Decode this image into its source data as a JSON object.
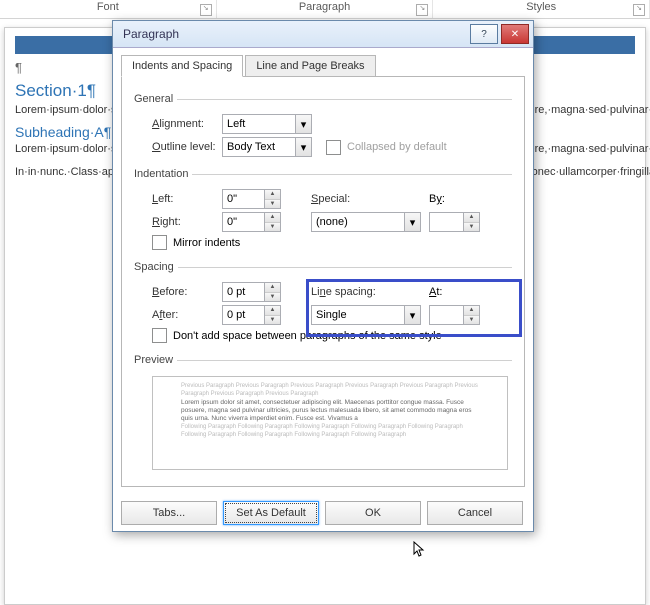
{
  "ribbon": {
    "groups": [
      "Font",
      "Paragraph",
      "Styles"
    ]
  },
  "document": {
    "heading1": "Section·1¶",
    "heading2": "Subheading·A¶",
    "lorem1": "Lorem·ipsum·dolor·sit·amet,·consectetuer·adipiscing·elit.·Maecenas·porttitor·congue·massa.·Fusce·posuere,·magna·sed·pulvinar·ultricies,·purus·lectus·malesuada·libero,·sit·amet·commodo·magna·eros·quis·urna.·Nunc·viverra·imperdiet·enim.·Fusce·est.·Vivamus·a·tellus.·Pellentesque·habitant·morbi·tristique·senectus·et·netus·et·malesuada·fames·ac·turpis·egestas.·Proin·pharetra·nonummy·pede.·Mauris·et·orci.·Aenean·nec·lorem.·In·porttitor.·Donec·laoreet·nonummy·augue.·Suspendisse·dui·purus,·scelerisque·at,·vulputate·vitae,·pretium·mattis,·nunc.·Mauris·eget·neque·at·sem·venenatis·eleifend.·Ut·nonummy.·Fusce·aliquet·pede·non·pede.·Suspendisse·dapibus·lorem·pellentesque·magna.·Integer·nulla.·Donec·blandit·feugiat·ligula.·Donec·hendrerit,·felis·et·imperdiet·euismod,·purus·ipsum·pretium·metus,·in·lacinia·nulla·nisl·eget·sapien.¶",
    "lorem2": "Lorem·ipsum·dolor·sit·amet,·consectetuer·adipiscing·elit.·Maecenas·porttitor·congue·massa.·Fusce·posuere,·magna·sed·pulvinar·ultricies,·purus·lectus·malesuada·libero,·sit·amet·commodo·magna·eros·quis·urna.·Nunc·viverra·imperdiet·enim.·Fusce·est.·Vivamus·a·tellus.·Pellentesque·habitant·morbi·tristique·senectus·et·netus·et·malesuada·fames·ac·turpis·egestas.·Proin·pharetra·nonummy·pede.·Mauris·et·orci.·Aenean·nec·lorem.·In·porttitor.·Donec·laoreet·nonummy·augue.·Suspendisse·dui·purus,·scelerisque·at,·vulputate·vitae,·pretium·mattis,·nunc.·Mauris·eget·neque·at·sem·venenatis·eleifend.·Ut·nonummy.·Fusce·aliquet·pede·non·pede.·Suspendisse·dapibus·lorem·pellentesque·magna.·Integer·nulla.·Donec·blandit·feugiat·ligula.·Donec·hendrerit,·felis·et·imperdiet·euismod,·purus·ipsum·pretium·metus,·in·lacinia·nulla·nisl·eget·sapien.¶",
    "footer_line": "In·in·nunc.·Class·aptent·taciti·sociosqu·ad·litora·torquent·per·conubia·nostra,·per·inceptos·hymenaeos.·Donec·ullamcorper·fringilla·eros.·Fusce·in·sapien·eu·purus·dapibus·commodo.·Cum·sociis·natoque"
  },
  "dialog": {
    "title": "Paragraph",
    "tabs": {
      "active": "Indents and Spacing",
      "inactive": "Line and Page Breaks"
    },
    "general": {
      "legend": "General",
      "alignment_label": "Alignment:",
      "alignment_value": "Left",
      "outline_label": "Outline level:",
      "outline_value": "Body Text",
      "collapsed_label": "Collapsed by default"
    },
    "indentation": {
      "legend": "Indentation",
      "left_label": "Left:",
      "left_value": "0\"",
      "right_label": "Right:",
      "right_value": "0\"",
      "special_label": "Special:",
      "special_value": "(none)",
      "by_label": "By:",
      "by_value": "",
      "mirror_label": "Mirror indents"
    },
    "spacing": {
      "legend": "Spacing",
      "before_label": "Before:",
      "before_value": "0 pt",
      "after_label": "After:",
      "after_value": "0 pt",
      "line_spacing_label": "Line spacing:",
      "line_spacing_value": "Single",
      "at_label": "At:",
      "at_value": "",
      "no_space_label": "Don't add space between paragraphs of the same style"
    },
    "preview": {
      "legend": "Preview",
      "prev_line": "Previous Paragraph Previous Paragraph Previous Paragraph Previous Paragraph Previous Paragraph Previous Paragraph Previous Paragraph Previous Paragraph",
      "main_line": "Lorem ipsum dolor sit amet, consectetuer adipiscing elit. Maecenas porttitor congue massa. Fusce posuere, magna sed pulvinar ultricies, purus lectus malesuada libero, sit amet commodo magna eros quis urna. Nunc viverra imperdiet enim. Fusce est. Vivamus a",
      "next_line": "Following Paragraph Following Paragraph Following Paragraph Following Paragraph Following Paragraph Following Paragraph Following Paragraph Following Paragraph Following Paragraph"
    },
    "buttons": {
      "tabs": "Tabs...",
      "set_default": "Set As Default",
      "ok": "OK",
      "cancel": "Cancel"
    }
  }
}
